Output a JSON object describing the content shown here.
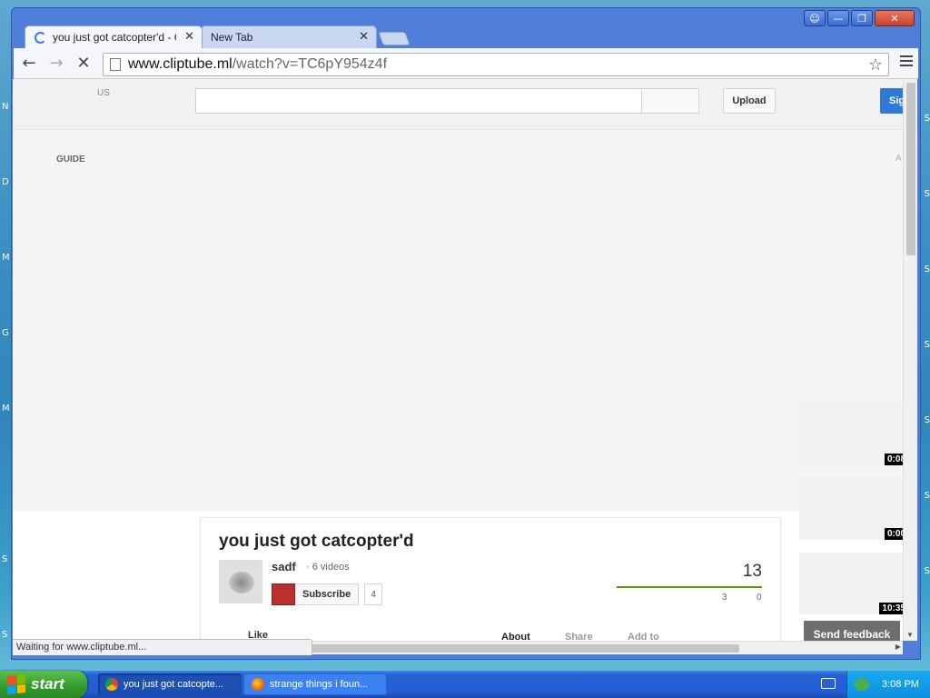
{
  "browser": {
    "tabs": [
      {
        "title": "you just got catcopter'd - Cli",
        "active": true
      },
      {
        "title": "New Tab",
        "active": false
      }
    ],
    "url_host": "www.cliptube.ml",
    "url_path": "/watch?v=TC6pY954z4f",
    "status_text": "Waiting for www.cliptube.ml..."
  },
  "page": {
    "country": "US",
    "upload_label": "Upload",
    "signin_label": "Sign in",
    "guide_label": "GUIDE",
    "right_letter": "A",
    "video": {
      "title": "you just got catcopter'd",
      "channel": "sadf",
      "video_count": "· 6 videos",
      "subscribe_label": "Subscribe",
      "subscriber_count": "4",
      "views": "13",
      "likes": "3",
      "dislikes": "0",
      "like_fraction": 1.0
    },
    "actions": {
      "like": "Like",
      "about": "About",
      "share": "Share",
      "add_to": "Add to"
    },
    "related_durations": [
      "0:08",
      "0:00",
      "10:35"
    ],
    "feedback_label": "Send feedback"
  },
  "taskbar": {
    "start_label": "start",
    "tasks": [
      {
        "label": "you just got catcopte...",
        "active": true
      },
      {
        "label": "strange things i foun...",
        "active": false
      }
    ],
    "clock": "3:08 PM"
  },
  "colors": {
    "like_bar": "#559900",
    "subscribe_red": "#b8312f",
    "signin_blue": "#2f7ad6",
    "start_green": "#2f9a2a"
  }
}
